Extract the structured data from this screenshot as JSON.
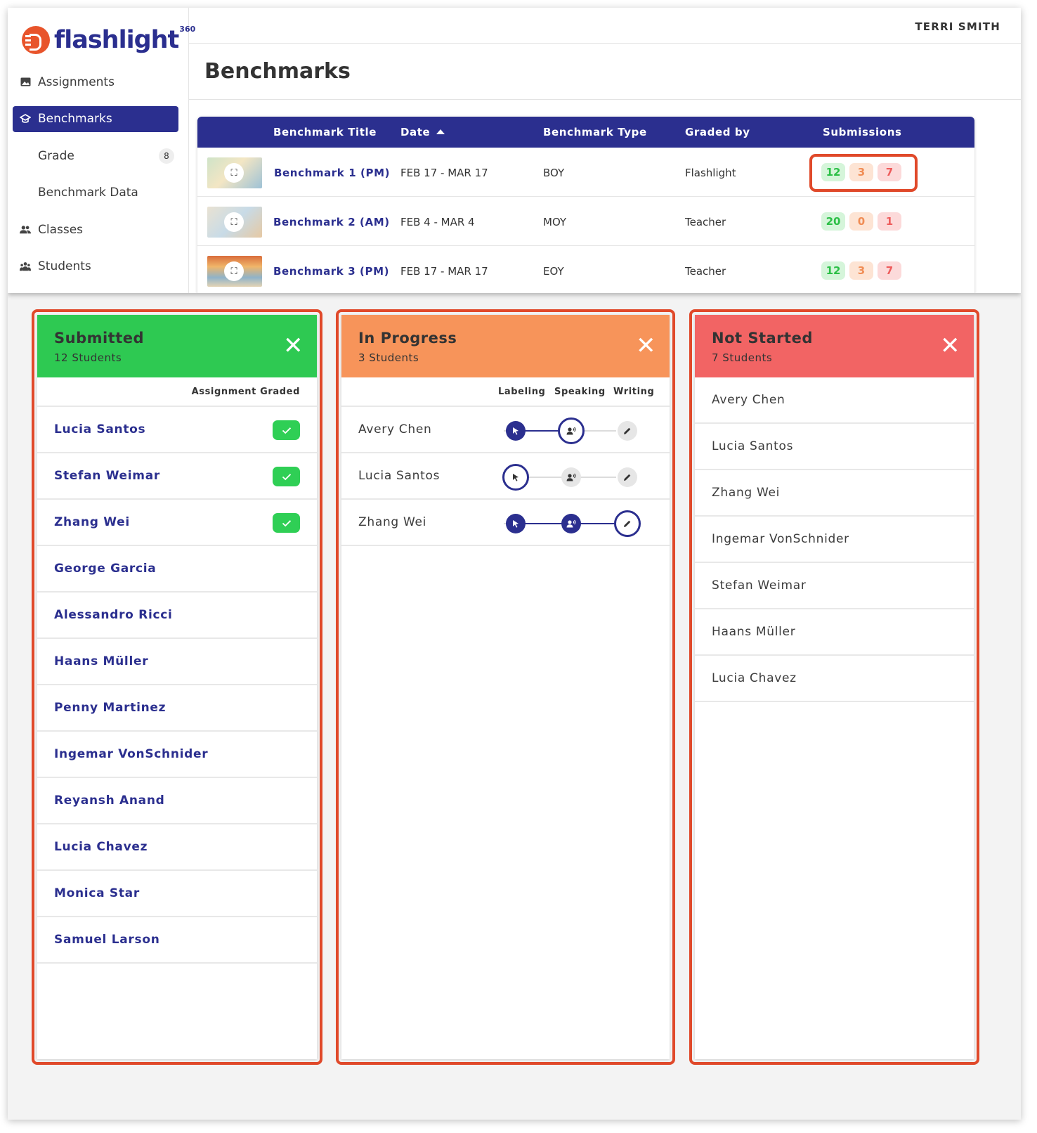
{
  "brand": {
    "name": "flashlight",
    "superscript": "360"
  },
  "user": {
    "name": "TERRI SMITH"
  },
  "sidebar": {
    "items": [
      {
        "label": "Assignments",
        "icon": "image-icon"
      },
      {
        "label": "Benchmarks",
        "icon": "graduation-cap-icon",
        "active": true
      },
      {
        "label": "Grade",
        "badge": "8",
        "sub": true
      },
      {
        "label": "Benchmark Data",
        "sub": true
      },
      {
        "label": "Classes",
        "icon": "people-icon"
      },
      {
        "label": "Students",
        "icon": "group-icon"
      }
    ]
  },
  "page": {
    "title": "Benchmarks"
  },
  "table": {
    "headers": {
      "title": "Benchmark Title",
      "date": "Date",
      "type": "Benchmark Type",
      "graded_by": "Graded by",
      "submissions": "Submissions"
    },
    "rows": [
      {
        "title": "Benchmark 1 (PM)",
        "date": "FEB 17 - MAR 17",
        "type": "BOY",
        "graded_by": "Flashlight",
        "submitted": "12",
        "in_progress": "3",
        "not_started": "7"
      },
      {
        "title": "Benchmark 2 (AM)",
        "date": "FEB 4 - MAR 4",
        "type": "MOY",
        "graded_by": "Teacher",
        "submitted": "20",
        "in_progress": "0",
        "not_started": "1"
      },
      {
        "title": "Benchmark 3 (PM)",
        "date": "FEB 17 - MAR 17",
        "type": "EOY",
        "graded_by": "Teacher",
        "submitted": "12",
        "in_progress": "3",
        "not_started": "7"
      }
    ]
  },
  "panels": {
    "submitted": {
      "title": "Submitted",
      "subtitle": "12 Students",
      "column": "Assignment Graded",
      "color": "#2ec952",
      "students": [
        "Lucia Santos",
        "Stefan Weimar",
        "Zhang Wei",
        "George Garcia",
        "Alessandro Ricci",
        "Haans Müller",
        "Penny Martinez",
        "Ingemar VonSchnider",
        "Reyansh Anand",
        "Lucia Chavez",
        "Monica Star",
        "Samuel Larson"
      ],
      "graded": [
        true,
        true,
        true,
        false,
        false,
        false,
        false,
        false,
        false,
        false,
        false,
        false
      ]
    },
    "in_progress": {
      "title": "In Progress",
      "subtitle": "3 Students",
      "color": "#f7945a",
      "columns": [
        "Labeling",
        "Speaking",
        "Writing"
      ],
      "students": [
        {
          "name": "Avery Chen",
          "step": 2
        },
        {
          "name": "Lucia Santos",
          "step": 1
        },
        {
          "name": "Zhang Wei",
          "step": 3
        }
      ]
    },
    "not_started": {
      "title": "Not Started",
      "subtitle": "7 Students",
      "color": "#f26464",
      "students": [
        "Avery Chen",
        "Lucia Santos",
        "Zhang Wei",
        "Ingemar VonSchnider",
        "Stefan Weimar",
        "Haans Müller",
        "Lucia Chavez"
      ]
    }
  },
  "colors": {
    "primary": "#2b2f8f",
    "highlight": "#e0492a"
  }
}
